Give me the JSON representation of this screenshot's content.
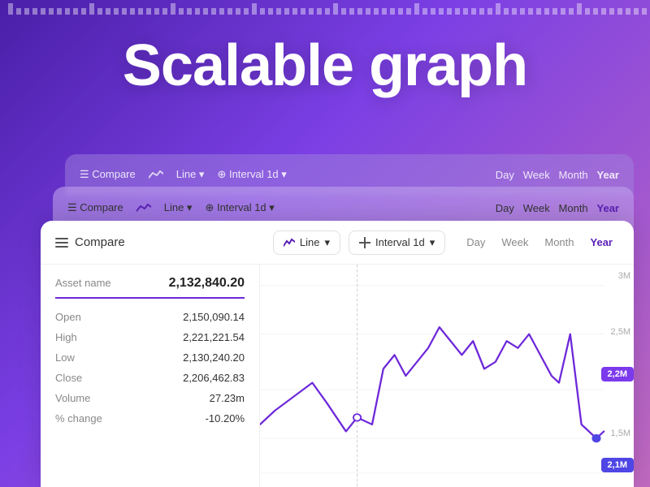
{
  "page": {
    "title": "Scalable graph",
    "background": "linear-gradient(135deg, #4a1fa8, #7b3fe4, #c06abf)"
  },
  "toolbar": {
    "compare_label": "Compare",
    "line_label": "Line",
    "interval_label": "Interval 1d",
    "time_buttons": [
      "Day",
      "Week",
      "Month",
      "Year"
    ],
    "active_time": "Year"
  },
  "asset": {
    "name_label": "Asset name",
    "value": "2,132,840.20",
    "stats": [
      {
        "label": "Open",
        "value": "2,150,090.14"
      },
      {
        "label": "High",
        "value": "2,221,221.54"
      },
      {
        "label": "Low",
        "value": "2,130,240.20"
      },
      {
        "label": "Close",
        "value": "2,206,462.83"
      },
      {
        "label": "Volume",
        "value": "27.23m"
      },
      {
        "label": "% change",
        "value": "-10.20%"
      }
    ]
  },
  "chart": {
    "y_labels": [
      "3M",
      "2,5M",
      "2,2M",
      "2,1M",
      "1,5M"
    ],
    "badges": [
      {
        "label": "2,2M",
        "color": "#5b21b6"
      },
      {
        "label": "2,1M",
        "color": "#4f46e5"
      }
    ]
  }
}
